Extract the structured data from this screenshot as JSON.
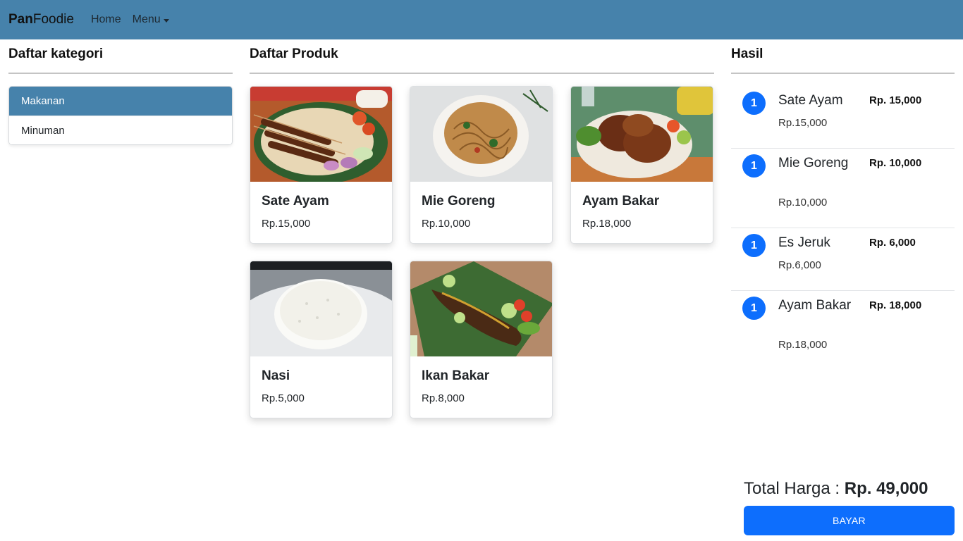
{
  "navbar": {
    "brand_bold": "Pan",
    "brand_rest": "Foodie",
    "home_label": "Home",
    "menu_label": "Menu"
  },
  "categories": {
    "title": "Daftar kategori",
    "items": [
      {
        "label": "Makanan",
        "active": true
      },
      {
        "label": "Minuman",
        "active": false
      }
    ]
  },
  "products": {
    "title": "Daftar Produk",
    "items": [
      {
        "name": "Sate Ayam",
        "price": "Rp.15,000"
      },
      {
        "name": "Mie Goreng",
        "price": "Rp.10,000"
      },
      {
        "name": "Ayam Bakar",
        "price": "Rp.18,000"
      },
      {
        "name": "Nasi",
        "price": "Rp.5,000"
      },
      {
        "name": "Ikan Bakar",
        "price": "Rp.8,000"
      }
    ]
  },
  "result": {
    "title": "Hasil",
    "items": [
      {
        "qty": "1",
        "name": "Sate Ayam",
        "unit_price": "Rp.15,000",
        "subtotal": "Rp. 15,000"
      },
      {
        "qty": "1",
        "name": "Mie Goreng",
        "unit_price": "Rp.10,000",
        "subtotal": "Rp. 10,000"
      },
      {
        "qty": "1",
        "name": "Es Jeruk",
        "unit_price": "Rp.6,000",
        "subtotal": "Rp. 6,000"
      },
      {
        "qty": "1",
        "name": "Ayam Bakar",
        "unit_price": "Rp.18,000",
        "subtotal": "Rp. 18,000"
      }
    ],
    "total_label": "Total Harga :",
    "total_value": "Rp. 49,000",
    "pay_label": "BAYAR"
  },
  "colors": {
    "navbar": "#4682ab",
    "badge": "#0d6efd",
    "pay_button": "#0d6efd"
  }
}
